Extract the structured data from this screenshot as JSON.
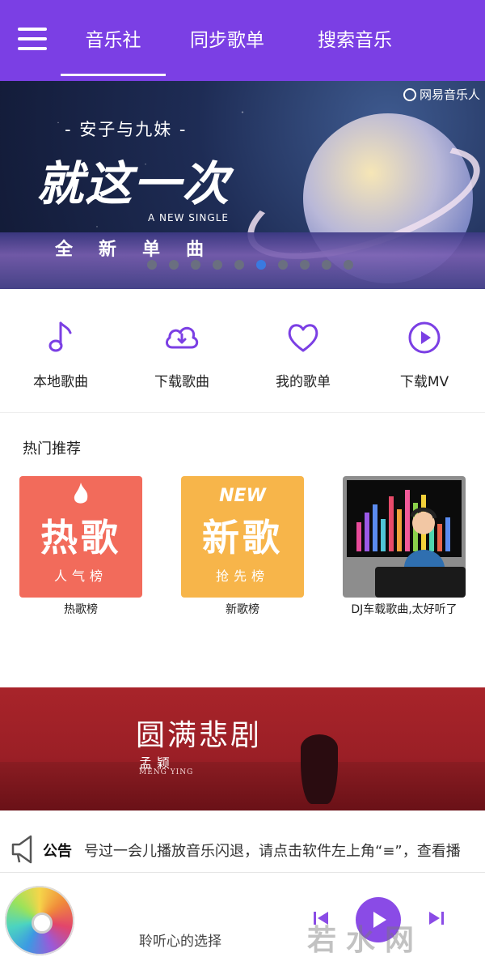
{
  "header": {
    "menu_icon": "hamburger-menu-icon",
    "tabs": [
      {
        "label": "音乐社",
        "active": true
      },
      {
        "label": "同步歌单",
        "active": false
      },
      {
        "label": "搜索音乐",
        "active": false
      }
    ],
    "accent_color": "#7b3fe4"
  },
  "banner": {
    "brand": "网易音乐人",
    "artist_line": "- 安子与九妹 -",
    "title": "就这一次",
    "subtitle_en": "A NEW SINGLE",
    "subtitle_cn": "全新单曲",
    "slides_total": 10,
    "active_index": 5
  },
  "quick_actions": [
    {
      "label": "本地歌曲",
      "icon": "music-note-icon"
    },
    {
      "label": "下载歌曲",
      "icon": "cloud-download-icon"
    },
    {
      "label": "我的歌单",
      "icon": "heart-icon"
    },
    {
      "label": "下载MV",
      "icon": "play-circle-icon"
    }
  ],
  "hot": {
    "title": "热门推荐",
    "cards": [
      {
        "caption": "热歌榜",
        "cover_big": "热歌",
        "cover_small": "人气榜",
        "color": "#f26b5b"
      },
      {
        "caption": "新歌榜",
        "cover_tag": "NEW",
        "cover_big": "新歌",
        "cover_small": "抢先榜",
        "color": "#f7b54a"
      },
      {
        "caption": "DJ车载歌曲,太好听了"
      }
    ]
  },
  "promo": {
    "title": "圆满悲剧",
    "artist": "孟颖",
    "artist_en": "MENG YING"
  },
  "notice": {
    "label": "公告",
    "text": "号过一会儿播放音乐闪退，请点击软件左上角“≡”，查看播"
  },
  "player": {
    "now_playing": "聆听心的选择",
    "watermark": "若水网"
  }
}
